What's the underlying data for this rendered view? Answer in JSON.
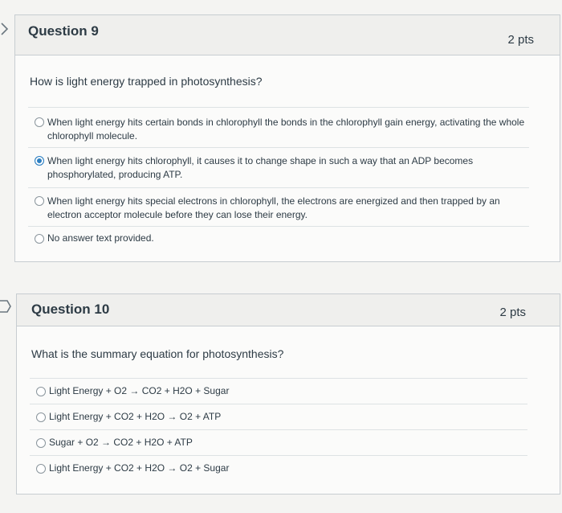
{
  "questions": [
    {
      "title": "Question 9",
      "points": "2 pts",
      "prompt": "How is light energy trapped in photosynthesis?",
      "answers": [
        {
          "text": "When light energy hits certain bonds in chlorophyll the bonds in the chlorophyll gain energy, activating the whole chlorophyll molecule.",
          "selected": false
        },
        {
          "text": "When light energy hits chlorophyll, it causes it to change shape in such a way that an ADP becomes phosphorylated, producing ATP.",
          "selected": true
        },
        {
          "text": "When light energy hits special electrons in chlorophyll, the electrons are energized and then trapped by an electron acceptor molecule before they can lose their energy.",
          "selected": false
        },
        {
          "text": "No answer text provided.",
          "selected": false
        }
      ]
    },
    {
      "title": "Question 10",
      "points": "2 pts",
      "prompt": "What is the summary equation for photosynthesis?",
      "answers": [
        {
          "text": "Light Energy + O2 → CO2 + H2O + Sugar",
          "selected": false
        },
        {
          "text": "Light Energy + CO2 + H2O → O2 + ATP",
          "selected": false
        },
        {
          "text": "Sugar + O2 → CO2 + H2O + ATP",
          "selected": false
        },
        {
          "text": "Light Energy + CO2 + H2O → O2 + Sugar",
          "selected": false
        }
      ]
    }
  ],
  "colors": {
    "accent": "#2d7fc1",
    "text": "#2d3b45",
    "border": "#c7cdd1"
  }
}
